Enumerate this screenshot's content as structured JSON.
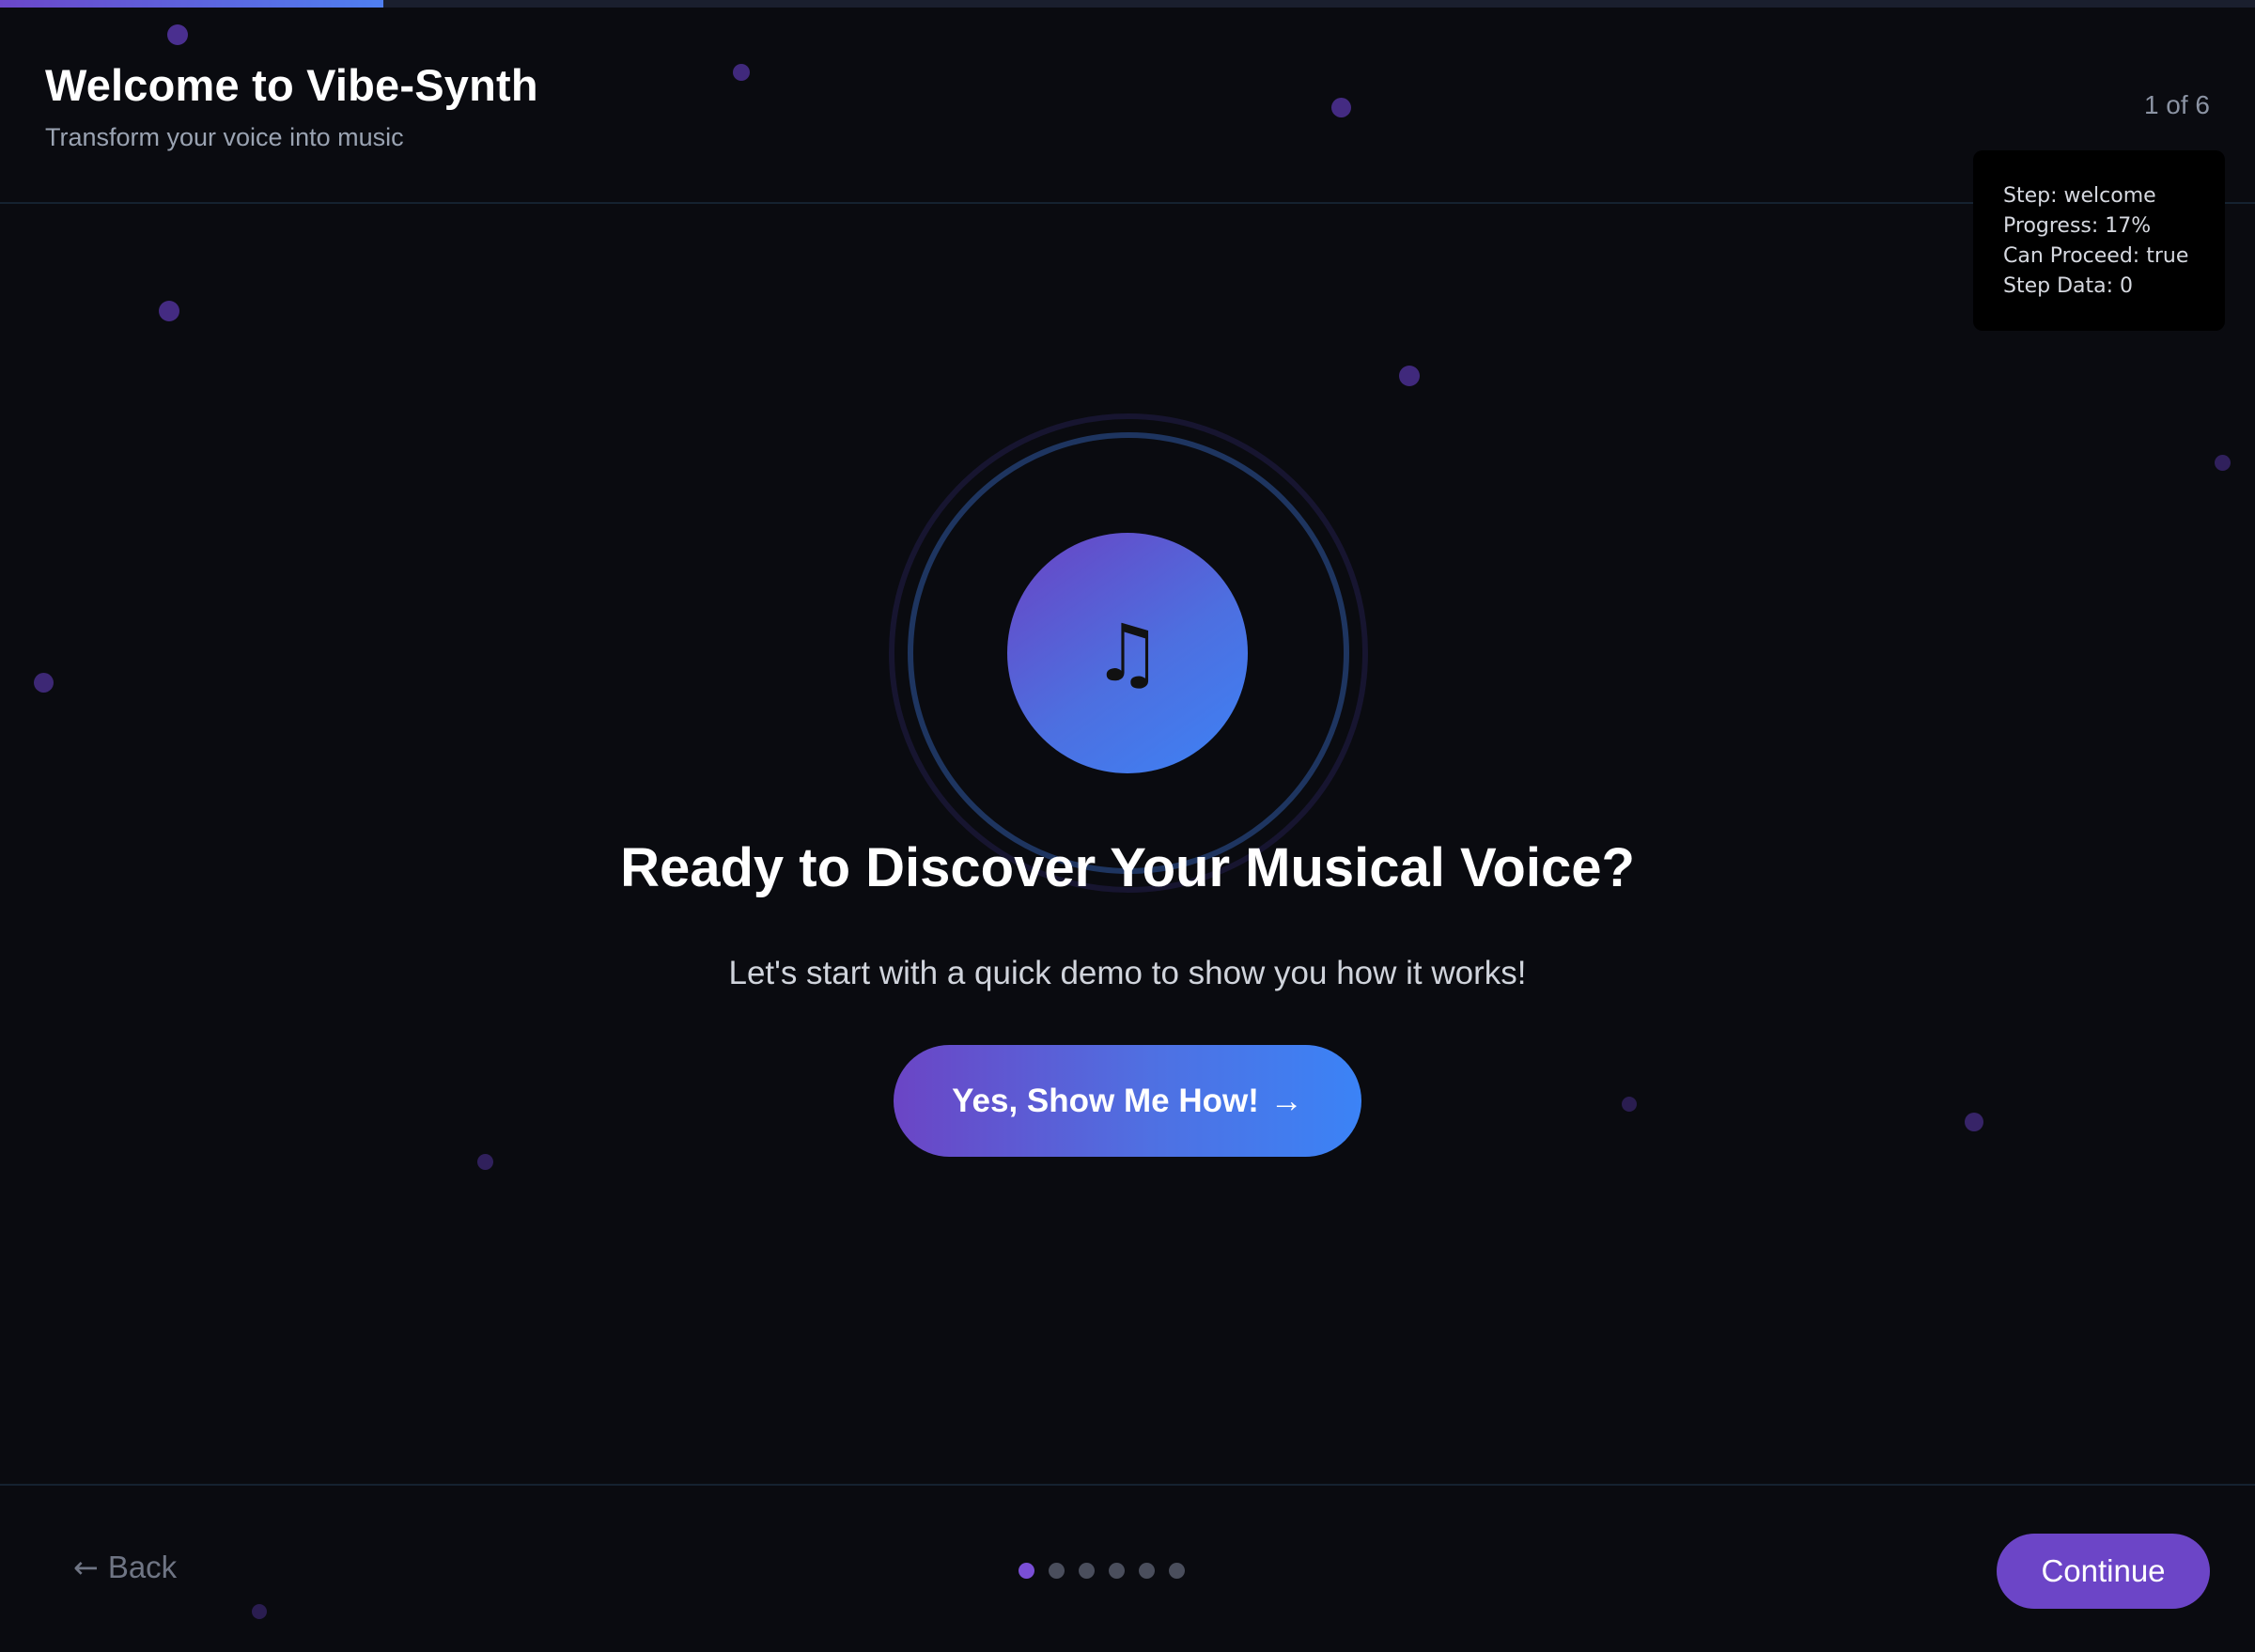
{
  "header": {
    "title": "Welcome to Vibe-Synth",
    "subtitle": "Transform your voice into music",
    "step_counter": "1 of 6"
  },
  "progress": {
    "fraction": 0.17
  },
  "debug": {
    "step": "Step: welcome",
    "progress": "Progress: 17%",
    "can_proceed": "Can Proceed: true",
    "step_data": "Step Data: 0"
  },
  "hero": {
    "icon": "music-note-icon",
    "icon_glyph": "♫",
    "title": "Ready to Discover Your Musical Voice?",
    "text": "Let's start with a quick demo to show you how it works!",
    "cta_label": "Yes, Show Me How!",
    "cta_arrow": "→"
  },
  "footer": {
    "back_arrow": "←",
    "back_label": "Back",
    "continue_label": "Continue",
    "dots_total": 6,
    "active_step": 1
  },
  "colors": {
    "background": "#0a0b10",
    "accent_purple": "#6c45c7",
    "accent_blue": "#3b83f6",
    "text_muted": "#9aa3b2"
  }
}
